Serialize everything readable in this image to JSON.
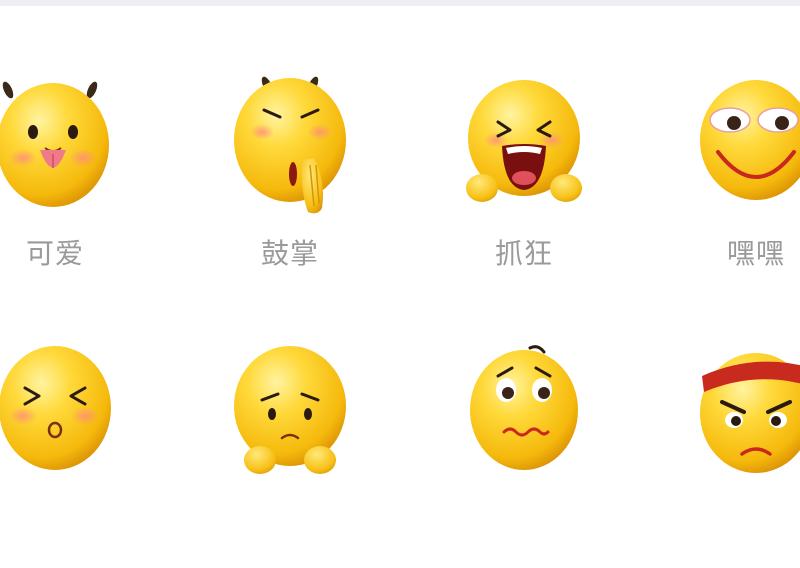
{
  "emoji_panel": {
    "items": [
      {
        "label": "可爱",
        "icon": "cute-tongue-face-icon"
      },
      {
        "label": "鼓掌",
        "icon": "clapping-face-icon"
      },
      {
        "label": "抓狂",
        "icon": "crazy-crying-face-icon"
      },
      {
        "label": "嘿嘿",
        "icon": "hehe-grin-face-icon"
      },
      {
        "icon": "kissing-squint-face-icon"
      },
      {
        "icon": "sad-hands-face-icon"
      },
      {
        "icon": "nervous-worried-face-icon"
      },
      {
        "icon": "angry-headband-face-icon"
      }
    ]
  },
  "colors": {
    "face_light": "#ffe66a",
    "face_mid": "#f9c514",
    "face_dark": "#e49a06",
    "label_text": "#9a9a9a",
    "blush": "#ff8a80",
    "headband": "#c82a1e"
  }
}
